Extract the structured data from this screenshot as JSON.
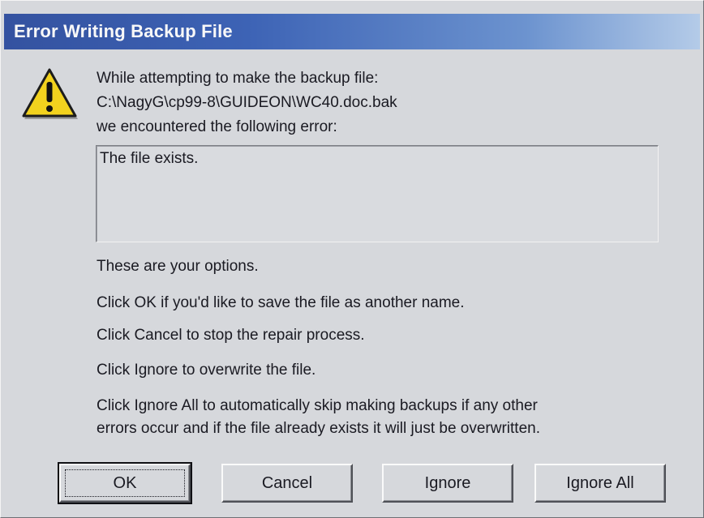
{
  "dialog": {
    "title": "Error Writing Backup File",
    "icon": "warning-icon",
    "message": {
      "line1": "While attempting to make the backup file:",
      "path": "C:\\NagyG\\cp99-8\\GUIDEON\\WC40.doc.bak",
      "line3": "we encountered the following error:"
    },
    "error_text": "The file exists.",
    "options": {
      "intro": "These are your options.",
      "ok": "Click OK if you'd like to save the file as another name.",
      "cancel": "Click Cancel to stop the repair process.",
      "ignore": "Click Ignore to overwrite the file.",
      "ignore_all_1": "Click Ignore All to automatically skip making backups if any other",
      "ignore_all_2": "errors occur and if the file already exists it will just be overwritten."
    },
    "buttons": {
      "ok": "OK",
      "cancel": "Cancel",
      "ignore": "Ignore",
      "ignore_all": "Ignore All"
    },
    "colors": {
      "title_start": "#3452a0",
      "title_end": "#b4cbe8",
      "warning_yellow": "#f2d21e",
      "face": "#d6d8dc"
    }
  }
}
